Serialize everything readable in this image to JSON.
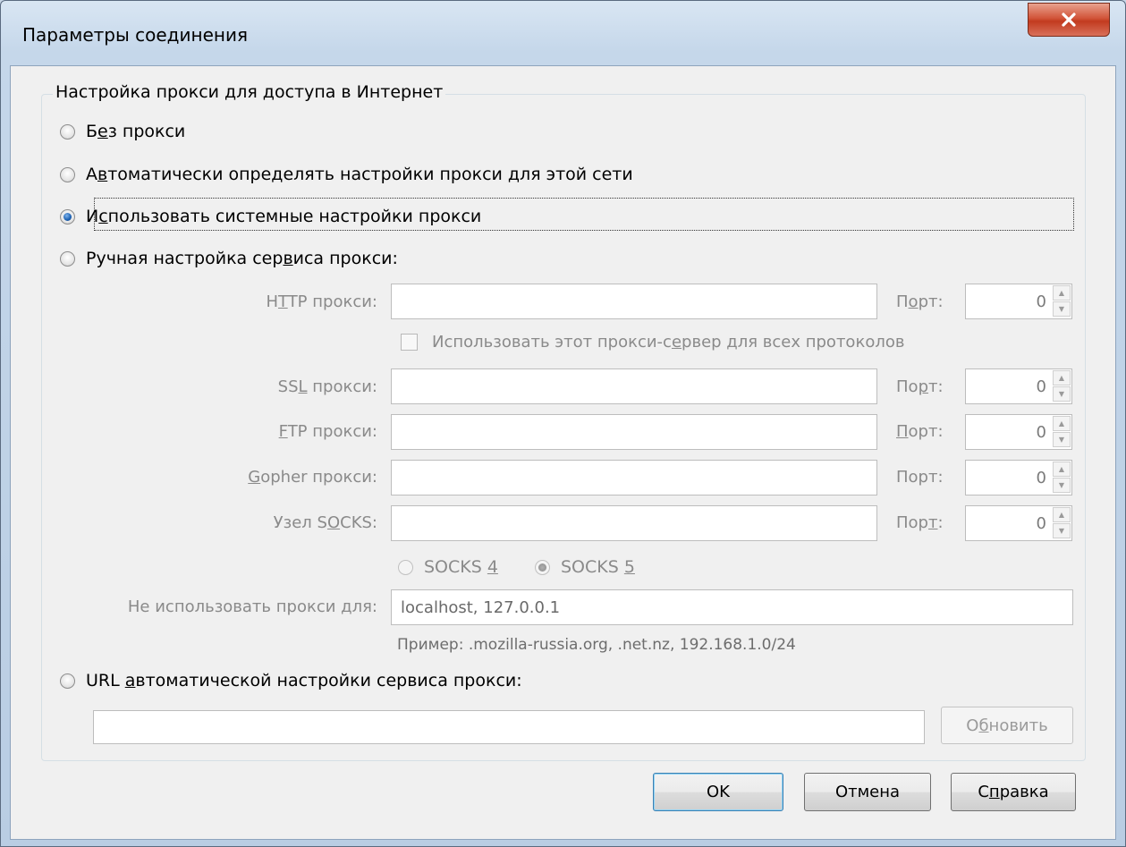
{
  "window": {
    "title": "Параметры соединения",
    "close_label": "x"
  },
  "group": {
    "legend": "Настройка прокси для доступа в Интернет"
  },
  "options": {
    "no_proxy": {
      "pre": "Б",
      "u": "е",
      "post": "з прокси",
      "checked": false
    },
    "auto_detect": {
      "pre": "А",
      "u": "в",
      "post": "томатически определять настройки прокси для этой сети",
      "checked": false
    },
    "system": {
      "pre": "И",
      "u": "с",
      "post": "пользовать системные настройки прокси",
      "checked": true
    },
    "manual": {
      "pre": "Ручная настройка сер",
      "u": "в",
      "post": "иса прокси:",
      "checked": false
    },
    "auto_url": {
      "pre": "URL ",
      "u": "а",
      "post": "втоматической настройки сервиса прокси:",
      "checked": false
    }
  },
  "manual": {
    "http": {
      "label_pre": "H",
      "label_u": "T",
      "label_post": "TP прокси:",
      "value": "",
      "port_pre": "П",
      "port_u": "о",
      "port_post": "рт:",
      "port": "0"
    },
    "use_for_all": {
      "pre": "Использовать этот прокси-с",
      "u": "е",
      "post": "рвер для всех протоколов",
      "checked": false
    },
    "ssl": {
      "label_pre": "SS",
      "label_u": "L",
      "label_post": " прокси:",
      "value": "",
      "port_pre": "По",
      "port_u": "р",
      "port_post": "т:",
      "port": "0"
    },
    "ftp": {
      "label_pre": "",
      "label_u": "F",
      "label_post": "TP прокси:",
      "value": "",
      "port_pre": "",
      "port_u": "П",
      "port_post": "орт:",
      "port": "0"
    },
    "gopher": {
      "label_pre": "",
      "label_u": "G",
      "label_post": "opher прокси:",
      "value": "",
      "port_pre": "Порт:",
      "port_u": "",
      "port_post": "",
      "port": "0"
    },
    "socks": {
      "label_pre": "Узел S",
      "label_u": "O",
      "label_post": "CKS:",
      "value": "",
      "port_pre": "Пор",
      "port_u": "т",
      "port_post": ":",
      "port": "0"
    },
    "socks4": {
      "pre": "SOCKS ",
      "u": "4",
      "checked": false
    },
    "socks5": {
      "pre": "SOCKS ",
      "u": "5",
      "checked": true
    },
    "no_proxy_for_label": "Не использовать прокси для:",
    "no_proxy_for_value": "localhost, 127.0.0.1",
    "example": "Пример: .mozilla-russia.org, .net.nz, 192.168.1.0/24"
  },
  "auto_url": {
    "value": "",
    "reload_pre": "О",
    "reload_u": "б",
    "reload_post": "новить"
  },
  "buttons": {
    "ok": "OK",
    "cancel": "Отмена",
    "help_pre": "С",
    "help_u": "п",
    "help_post": "равка"
  }
}
